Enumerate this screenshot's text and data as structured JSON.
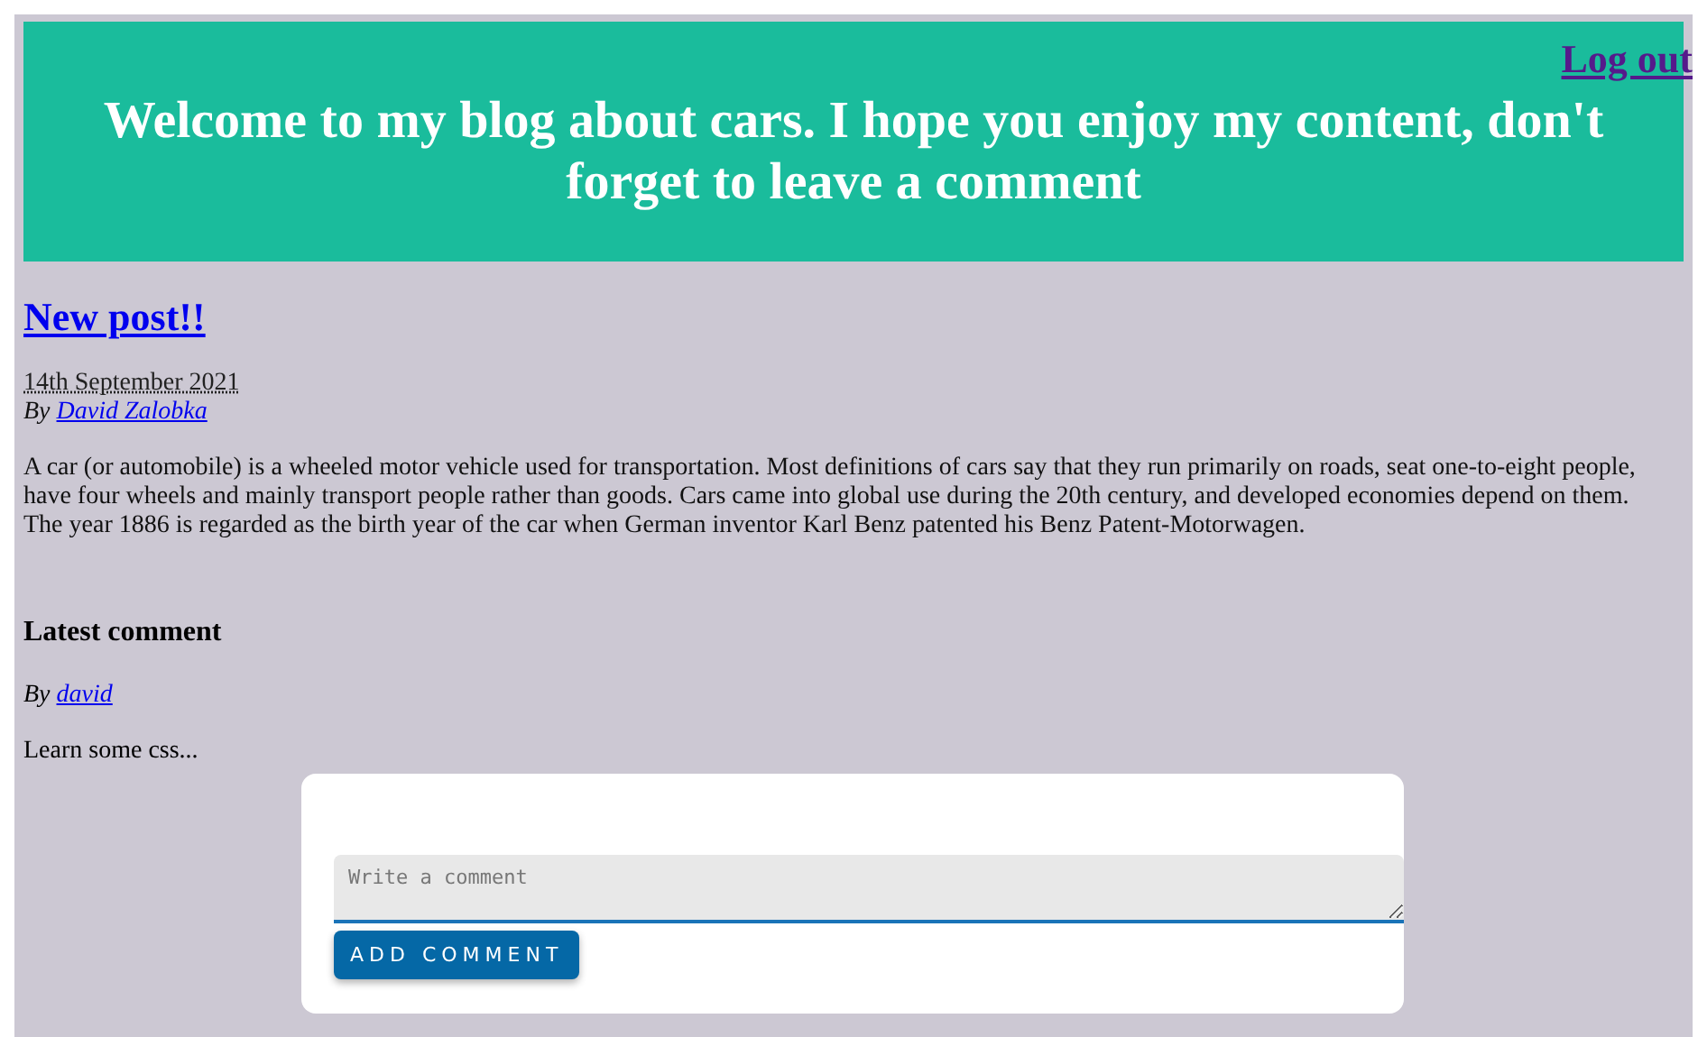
{
  "header": {
    "title": "Welcome to my blog about cars. I hope you enjoy my content, don't forget to leave a comment",
    "logout_link": "Log out"
  },
  "post": {
    "title": "New post!!",
    "date": "14th September 2021",
    "by": "By",
    "author": "David Zalobka",
    "body": "A car (or automobile) is a wheeled motor vehicle used for transportation. Most definitions of cars say that they run primarily on roads, seat one-to-eight people, have four wheels and mainly transport people rather than goods. Cars came into global use during the 20th century, and developed economies depend on them. The year 1886 is regarded as the birth year of the car when German inventor Karl Benz patented his Benz Patent-Motorwagen."
  },
  "latest_comment": {
    "heading": "Latest comment",
    "by": "By",
    "author": "david",
    "text": "Learn some css..."
  },
  "comment_form": {
    "placeholder": "Write a comment",
    "button": "ADD COMMENT"
  }
}
